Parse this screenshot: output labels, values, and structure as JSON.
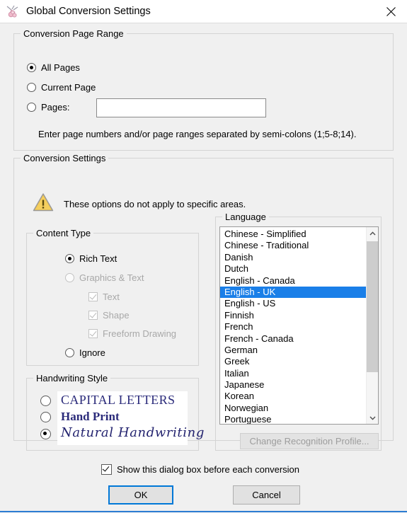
{
  "window": {
    "title": "Global Conversion Settings",
    "icon": "pen-flower-icon",
    "close_label": "✕"
  },
  "page_range": {
    "legend": "Conversion Page Range",
    "options": [
      {
        "label": "All Pages",
        "selected": true
      },
      {
        "label": "Current Page",
        "selected": false
      },
      {
        "label": "Pages:",
        "selected": false
      }
    ],
    "pages_value": "",
    "pages_placeholder": "",
    "hint": "Enter page numbers and/or page ranges separated by semi-colons (1;5-8;14)."
  },
  "conversion_settings": {
    "legend": "Conversion Settings",
    "warning_icon": "warning-triangle-icon",
    "warning_text": "These options do not apply to specific areas."
  },
  "content_type": {
    "legend": "Content Type",
    "options": [
      {
        "label": "Rich Text",
        "selected": true,
        "disabled": false
      },
      {
        "label": "Graphics & Text",
        "selected": false,
        "disabled": true
      },
      {
        "label": "Ignore",
        "selected": false,
        "disabled": false
      }
    ],
    "sub_options": [
      {
        "label": "Text",
        "checked": true,
        "disabled": true
      },
      {
        "label": "Shape",
        "checked": true,
        "disabled": true
      },
      {
        "label": "Freeform Drawing",
        "checked": true,
        "disabled": true
      }
    ]
  },
  "handwriting_style": {
    "legend": "Handwriting Style",
    "options": [
      {
        "label": "CAPITAL LETTERS",
        "selected": false
      },
      {
        "label": "Hand Print",
        "selected": false
      },
      {
        "label": "Natural Handwriting",
        "selected": true
      }
    ],
    "sample_color": "#2a2a7a"
  },
  "language": {
    "legend": "Language",
    "items": [
      "Chinese - Simplified",
      "Chinese - Traditional",
      "Danish",
      "Dutch",
      "English - Canada",
      "English - UK",
      "English - US",
      "Finnish",
      "French",
      "French - Canada",
      "German",
      "Greek",
      "Italian",
      "Japanese",
      "Korean",
      "Norwegian",
      "Portuguese"
    ],
    "selected": "English - UK",
    "scroll_up_icon": "chevron-up-icon",
    "scroll_down_icon": "chevron-down-icon",
    "change_profile_label": "Change Recognition Profile...",
    "change_profile_disabled": true
  },
  "footer": {
    "show_dialog_label": "Show this dialog box before each conversion",
    "show_dialog_checked": true,
    "ok_label": "OK",
    "cancel_label": "Cancel"
  },
  "colors": {
    "accent": "#0078d7",
    "selection": "#1a7fe8",
    "dialog_bg": "#f0f0f0",
    "handwriting": "#2a2a7a",
    "warning": "#f2c14b"
  }
}
